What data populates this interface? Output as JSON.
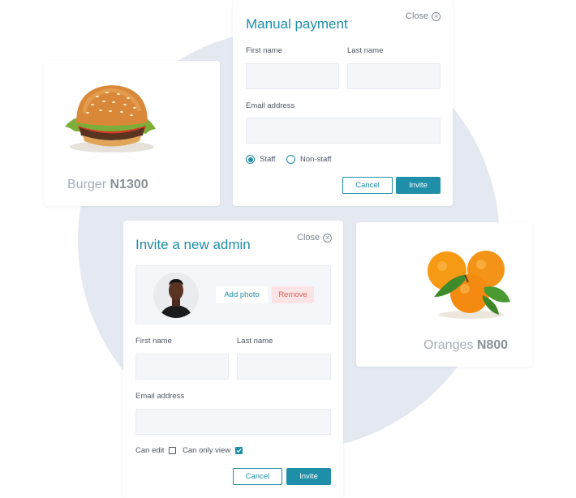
{
  "products": [
    {
      "name": "Burger",
      "price": "N1300"
    },
    {
      "name": "Oranges",
      "price": "N800"
    }
  ],
  "manual_payment": {
    "title": "Manual payment",
    "close_label": "Close",
    "first_name_label": "First name",
    "first_name_value": "",
    "last_name_label": "Last name",
    "last_name_value": "",
    "email_label": "Email address",
    "email_value": "",
    "roles": [
      {
        "label": "Staff",
        "selected": true
      },
      {
        "label": "Non-staff",
        "selected": false
      }
    ],
    "cancel_label": "Cancel",
    "invite_label": "Invite"
  },
  "invite_admin": {
    "title": "Invite a new admin",
    "close_label": "Close",
    "add_photo_label": "Add photo",
    "remove_label": "Remove",
    "first_name_label": "First name",
    "first_name_value": "",
    "last_name_label": "Last name",
    "last_name_value": "",
    "email_label": "Email address",
    "email_value": "",
    "permissions": [
      {
        "label": "Can edit",
        "checked": false
      },
      {
        "label": "Can only view",
        "checked": true
      }
    ],
    "cancel_label": "Cancel",
    "invite_label": "Invite"
  },
  "colors": {
    "accent": "#1f8ea8",
    "background_circle": "#e4e8f1",
    "remove_bg": "#fde4e4",
    "remove_text": "#e25d5d"
  },
  "icons": [
    "burger-image",
    "oranges-image",
    "close-circle-icon",
    "check-icon",
    "avatar-photo"
  ]
}
